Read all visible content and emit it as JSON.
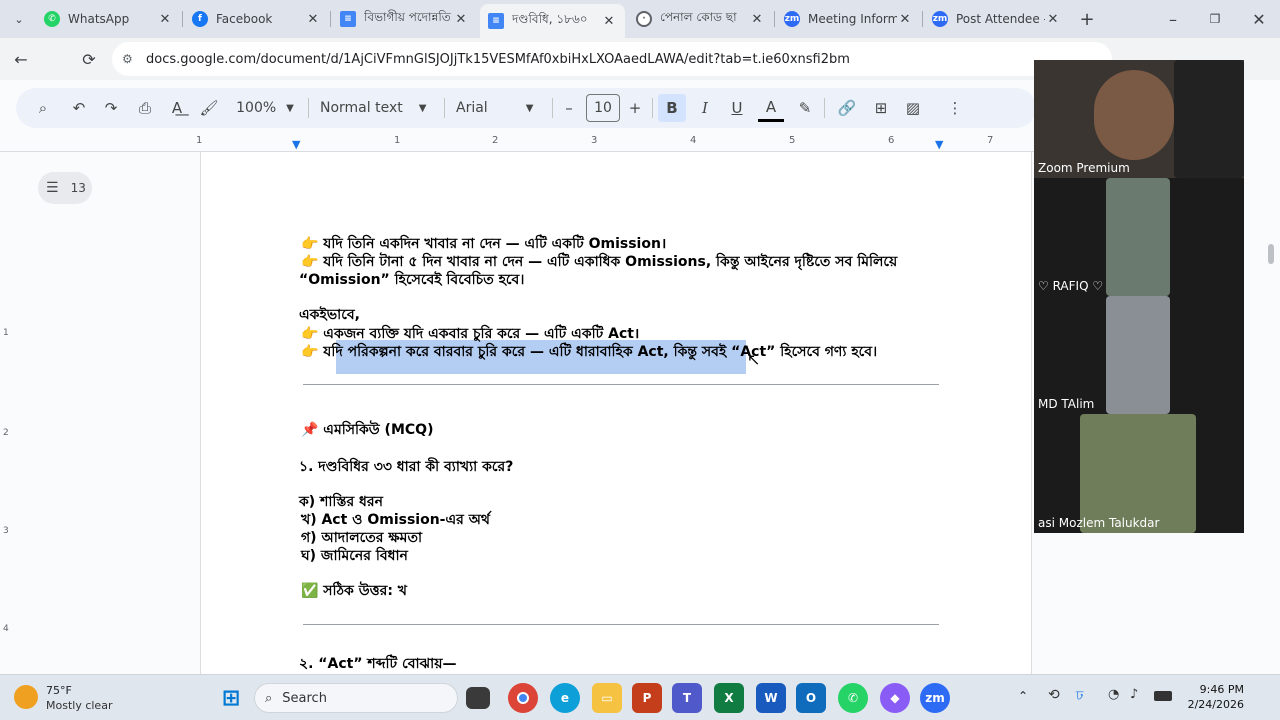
{
  "tabs": [
    {
      "title": "WhatsApp",
      "icon": "whatsapp-icon"
    },
    {
      "title": "Facebook",
      "icon": "facebook-icon"
    },
    {
      "title": "বিভাগীয় পদোন্নতি",
      "icon": "docs-icon"
    },
    {
      "title": "দণ্ডবিধি, ১৮৬০",
      "icon": "docs-icon"
    },
    {
      "title": "পেনাল কোড ছা",
      "icon": "globe-icon"
    },
    {
      "title": "Meeting Informa",
      "icon": "zoom-icon"
    },
    {
      "title": "Post Attendee -",
      "icon": "zoom-icon"
    }
  ],
  "address": "docs.google.com/document/d/1AjCiVFmnGlSJOJjTk15VESMfAf0xbiHxLXOAaedLAWA/edit?tab=t.ie60xnsfi2bm",
  "toolbar": {
    "zoom": "100%",
    "style": "Normal text",
    "font": "Arial",
    "size": "10"
  },
  "ruler": [
    "1",
    "1",
    "2",
    "3",
    "4",
    "5",
    "6",
    "7"
  ],
  "vruler": [
    "1",
    "2",
    "3",
    "4"
  ],
  "outline_count": "13",
  "doc": {
    "l1": "👉 যদি তিনি একদিন খাবার না দেন — এটি একটি Omission।",
    "l2": " 👉 যদি তিনি টানা ৫ দিন খাবার না দেন — এটি একাধিক Omissions, কিন্তু আইনের দৃষ্টিতে সব মিলিয়ে",
    "l3": "“Omission” হিসেবেই বিবেচিত হবে।",
    "l4": "একইভাবে,",
    "l5": " 👉 একজন ব্যক্তি যদি একবার চুরি করে — এটি একটি Act।",
    "l6": " 👉 যদি পরিকল্পনা করে বারবার চুরি করে — এটি ধারাবাহিক Act, কিন্তু সবই “Act” হিসেবে গণ্য হবে।",
    "l7": "📌 এমসিকিউ (MCQ)",
    "l8": "১. দণ্ডবিধির ৩৩ ধারা কী ব্যাখ্যা করে?",
    "l9": "ক) শাস্তির ধরন",
    "l10": " খ) Act ও Omission-এর অর্থ",
    "l11": " গ) আদালতের ক্ষমতা",
    "l12": " ঘ) জামিনের বিধান",
    "l13": "✅ সঠিক উত্তর: খ",
    "l14": "২. “Act” শব্দটি বোঝায়—"
  },
  "zoom": [
    {
      "name": "Zoom Premium"
    },
    {
      "name": "♡  RAFIQ  ♡"
    },
    {
      "name": "MD TAlim"
    },
    {
      "name": "asi Mozlem Talukdar"
    }
  ],
  "weather": {
    "temp": "75°F",
    "desc": "Mostly clear"
  },
  "search": "Search",
  "clock": {
    "time": "9:46 PM",
    "date": "2/24/2026"
  }
}
